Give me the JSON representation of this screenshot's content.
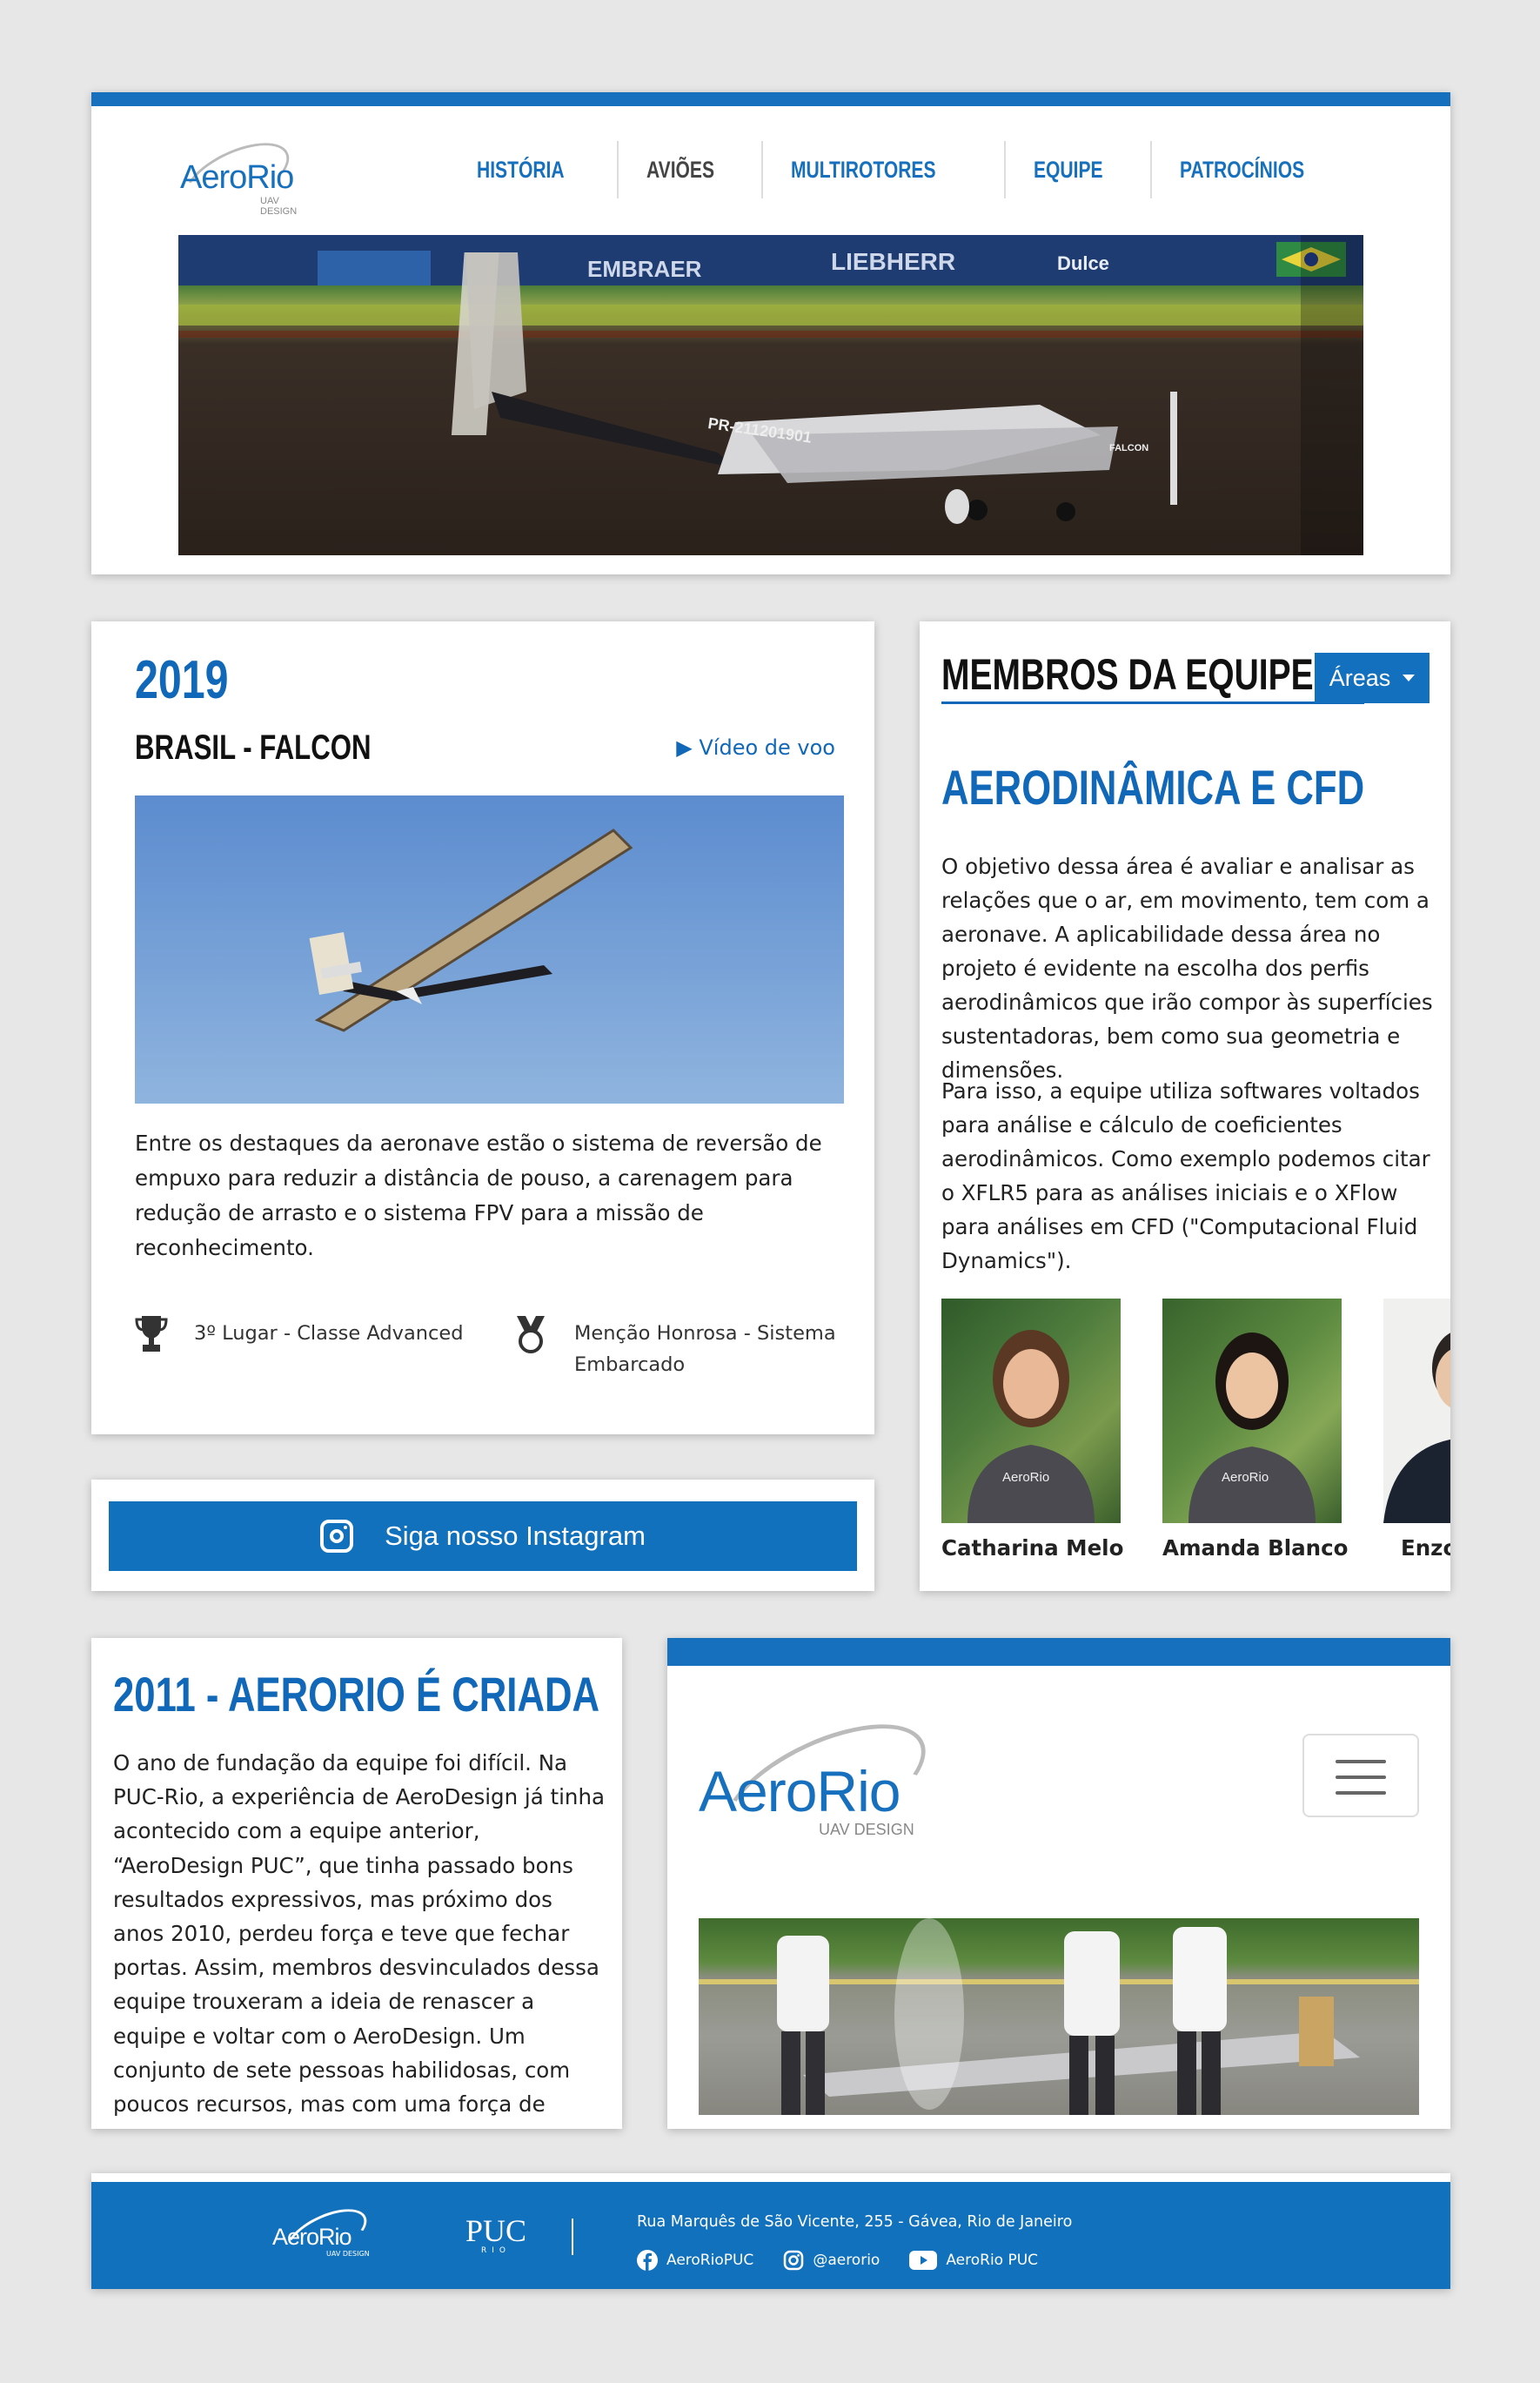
{
  "header": {
    "logo": {
      "name": "AeroRio",
      "sub": "UAV DESIGN"
    },
    "nav": [
      "HISTÓRIA",
      "AVIÕES",
      "MULTIROTORES",
      "EQUIPE",
      "PATROCÍNIOS"
    ],
    "active_nav": "AVIÕES",
    "banner": {
      "signs": [
        "EMBRAER",
        "LIEBHERR",
        "Dulce"
      ],
      "plane_label": "PR-211201901",
      "plane_name": "FALCON"
    }
  },
  "plane": {
    "year": "2019",
    "name": "BRASIL - FALCON",
    "video_link": "Vídeo de voo",
    "description": "Entre os destaques da aeronave estão o sistema de reversão de empuxo para reduzir a distância de pouso, a carenagem para redução de arrasto e o sistema FPV para a missão de reconhecimento.",
    "awards": [
      {
        "icon": "trophy-icon",
        "text": "3º Lugar - Classe Advanced"
      },
      {
        "icon": "medal-icon",
        "text": "Menção Honrosa - Sistema Embarcado"
      }
    ]
  },
  "instagram": {
    "label": "Siga nosso Instagram"
  },
  "team": {
    "title": "MEMBROS DA EQUIPE",
    "dropdown": "Áreas",
    "section": "AERODINÂMICA E CFD",
    "paragraphs": [
      "O objetivo dessa área é avaliar e analisar as relações que o ar, em movimento, tem com a aeronave. A aplicabilidade dessa área no projeto é evidente na escolha dos perfis aerodinâmicos que irão compor às superfícies sustentadoras, bem como sua geometria e dimensões.",
      "Para isso, a equipe utiliza softwares voltados para análise e cálculo de coeficientes aerodinâmicos. Como exemplo podemos citar o XFLR5 para as análises iniciais e o XFlow para análises em CFD (\"Computacional Fluid Dynamics\")."
    ],
    "members": [
      "Catharina Melo",
      "Amanda Blanco",
      "Enzo"
    ],
    "shirt_text": "AeroRio"
  },
  "history": {
    "title": "2011 - AERORIO É CRIADA",
    "text": "O ano de fundação da equipe foi difícil. Na PUC-Rio, a experiência de AeroDesign já tinha acontecido com a equipe anterior, “AeroDesign PUC”, que tinha passado bons resultados expressivos, mas próximo dos anos 2010, perdeu força e teve que fechar portas. Assim, membros desvinculados dessa equipe trouxeram a ideia de renascer a equipe e voltar com o AeroDesign. Um conjunto de sete pessoas habilidosas, com poucos recursos, mas com uma força de vontade sem igual, criaram a equipe AeroRio."
  },
  "mobile": {
    "logo": "AeroRio",
    "sub": "UAV DESIGN"
  },
  "footer": {
    "logo": "AeroRio",
    "logo_sub": "UAV DESIGN",
    "puc": "PUC",
    "puc_sub": "RIO",
    "address": "Rua Marquês de São Vicente, 255 - Gávea, Rio de Janeiro",
    "social": [
      {
        "icon": "facebook-icon",
        "label": "AeroRioPUC"
      },
      {
        "icon": "instagram-icon",
        "label": "@aerorio"
      },
      {
        "icon": "youtube-icon",
        "label": "AeroRio PUC"
      }
    ]
  },
  "colors": {
    "brand": "#1670bd",
    "background": "#e7e7e7",
    "text": "#222222"
  }
}
